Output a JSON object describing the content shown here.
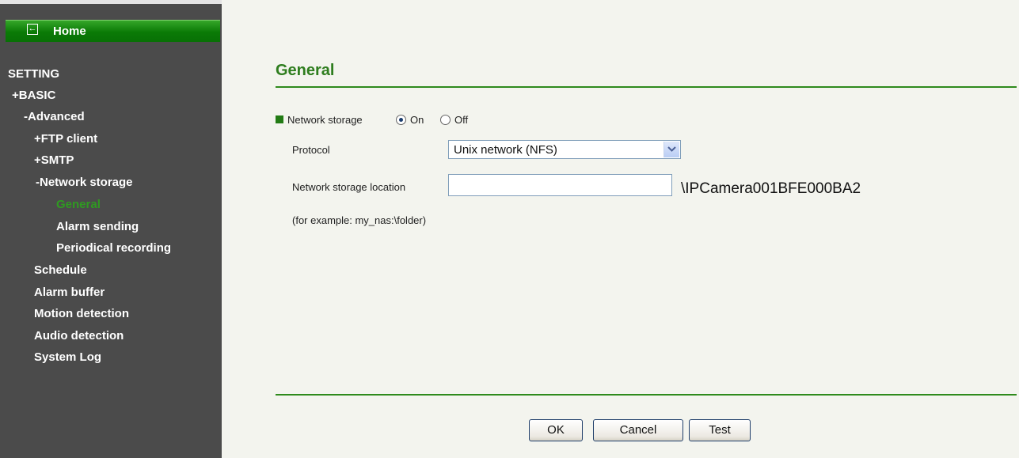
{
  "sidebar": {
    "home_label": "Home",
    "setting_label": "SETTING",
    "items": [
      {
        "label": "+BASIC"
      },
      {
        "label": "-Advanced"
      },
      {
        "label": "+FTP client"
      },
      {
        "label": "+SMTP"
      },
      {
        "label": "-Network storage"
      },
      {
        "label": "General"
      },
      {
        "label": "Alarm sending"
      },
      {
        "label": "Periodical recording"
      },
      {
        "label": "Schedule"
      },
      {
        "label": "Alarm buffer"
      },
      {
        "label": "Motion detection"
      },
      {
        "label": "Audio detection"
      },
      {
        "label": "System Log"
      }
    ]
  },
  "main": {
    "title": "General",
    "network_storage": {
      "label": "Network storage",
      "on_label": "On",
      "off_label": "Off",
      "selected": "On"
    },
    "protocol": {
      "label": "Protocol",
      "value": "Unix network (NFS)"
    },
    "location": {
      "label": "Network storage location",
      "value": "",
      "suffix": "\\IPCamera001BFE000BA2"
    },
    "example": "(for example: my_nas:\\folder)",
    "buttons": {
      "ok": "OK",
      "cancel": "Cancel",
      "test": "Test"
    }
  },
  "colors": {
    "accent_green": "#2e7d1e",
    "sidebar_bg": "#4b4b4b",
    "content_bg": "#f3f4ee"
  }
}
